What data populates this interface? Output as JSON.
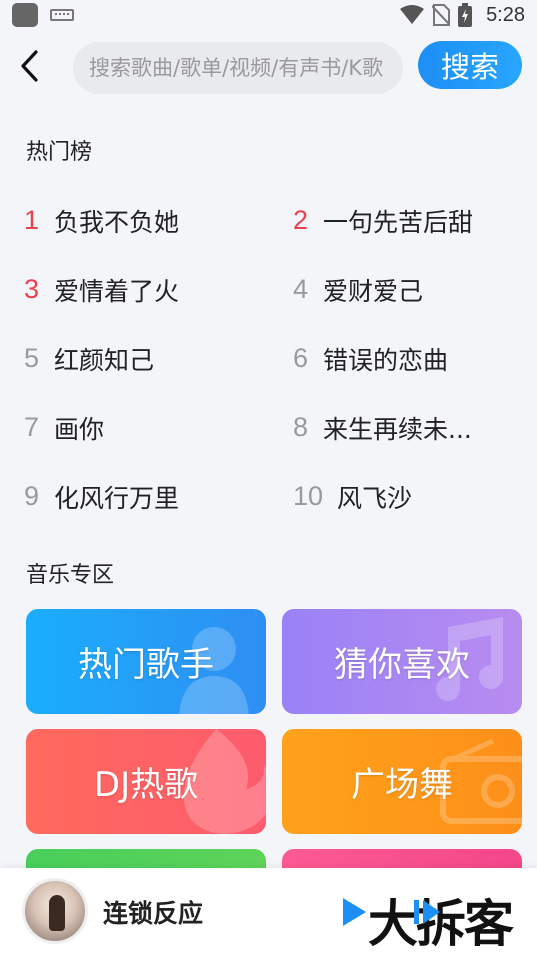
{
  "status_bar": {
    "time": "5:28",
    "icons": [
      "app-icon",
      "keyboard-icon",
      "wifi-icon",
      "no-sim-icon",
      "battery-icon"
    ]
  },
  "top_bar": {
    "back_icon": "chevron-left-icon",
    "search_placeholder": "搜索歌曲/歌单/视频/有声书/K歌",
    "search_button": "搜索"
  },
  "hot_chart": {
    "title": "热门榜",
    "items": [
      {
        "rank": "1",
        "name": "负我不负她"
      },
      {
        "rank": "2",
        "name": "一句先苦后甜"
      },
      {
        "rank": "3",
        "name": "爱情着了火"
      },
      {
        "rank": "4",
        "name": "爱财爱己"
      },
      {
        "rank": "5",
        "name": "红颜知己"
      },
      {
        "rank": "6",
        "name": "错误的恋曲"
      },
      {
        "rank": "7",
        "name": "画你"
      },
      {
        "rank": "8",
        "name": "来生再续未..."
      },
      {
        "rank": "9",
        "name": "化风行万里"
      },
      {
        "rank": "10",
        "name": "风飞沙"
      }
    ]
  },
  "music_zone": {
    "title": "音乐专区",
    "cards": [
      {
        "label": "热门歌手",
        "icon": "singer-icon"
      },
      {
        "label": "猜你喜欢",
        "icon": "music-note-heart-icon"
      },
      {
        "label": "DJ热歌",
        "icon": "flame-icon"
      },
      {
        "label": "广场舞",
        "icon": "radio-icon"
      },
      {
        "label": "",
        "icon": ""
      },
      {
        "label": "",
        "icon": ""
      }
    ]
  },
  "player": {
    "title": "连锁反应",
    "watermark": "大拆客",
    "play_icon": "play-icon",
    "playlist_icon": "playlist-icon"
  },
  "colors": {
    "accent_blue": "#1d8ef5",
    "rank_top_red": "#e8424f",
    "rank_gray": "#9a9a9a",
    "background": "#f3f5f8"
  }
}
